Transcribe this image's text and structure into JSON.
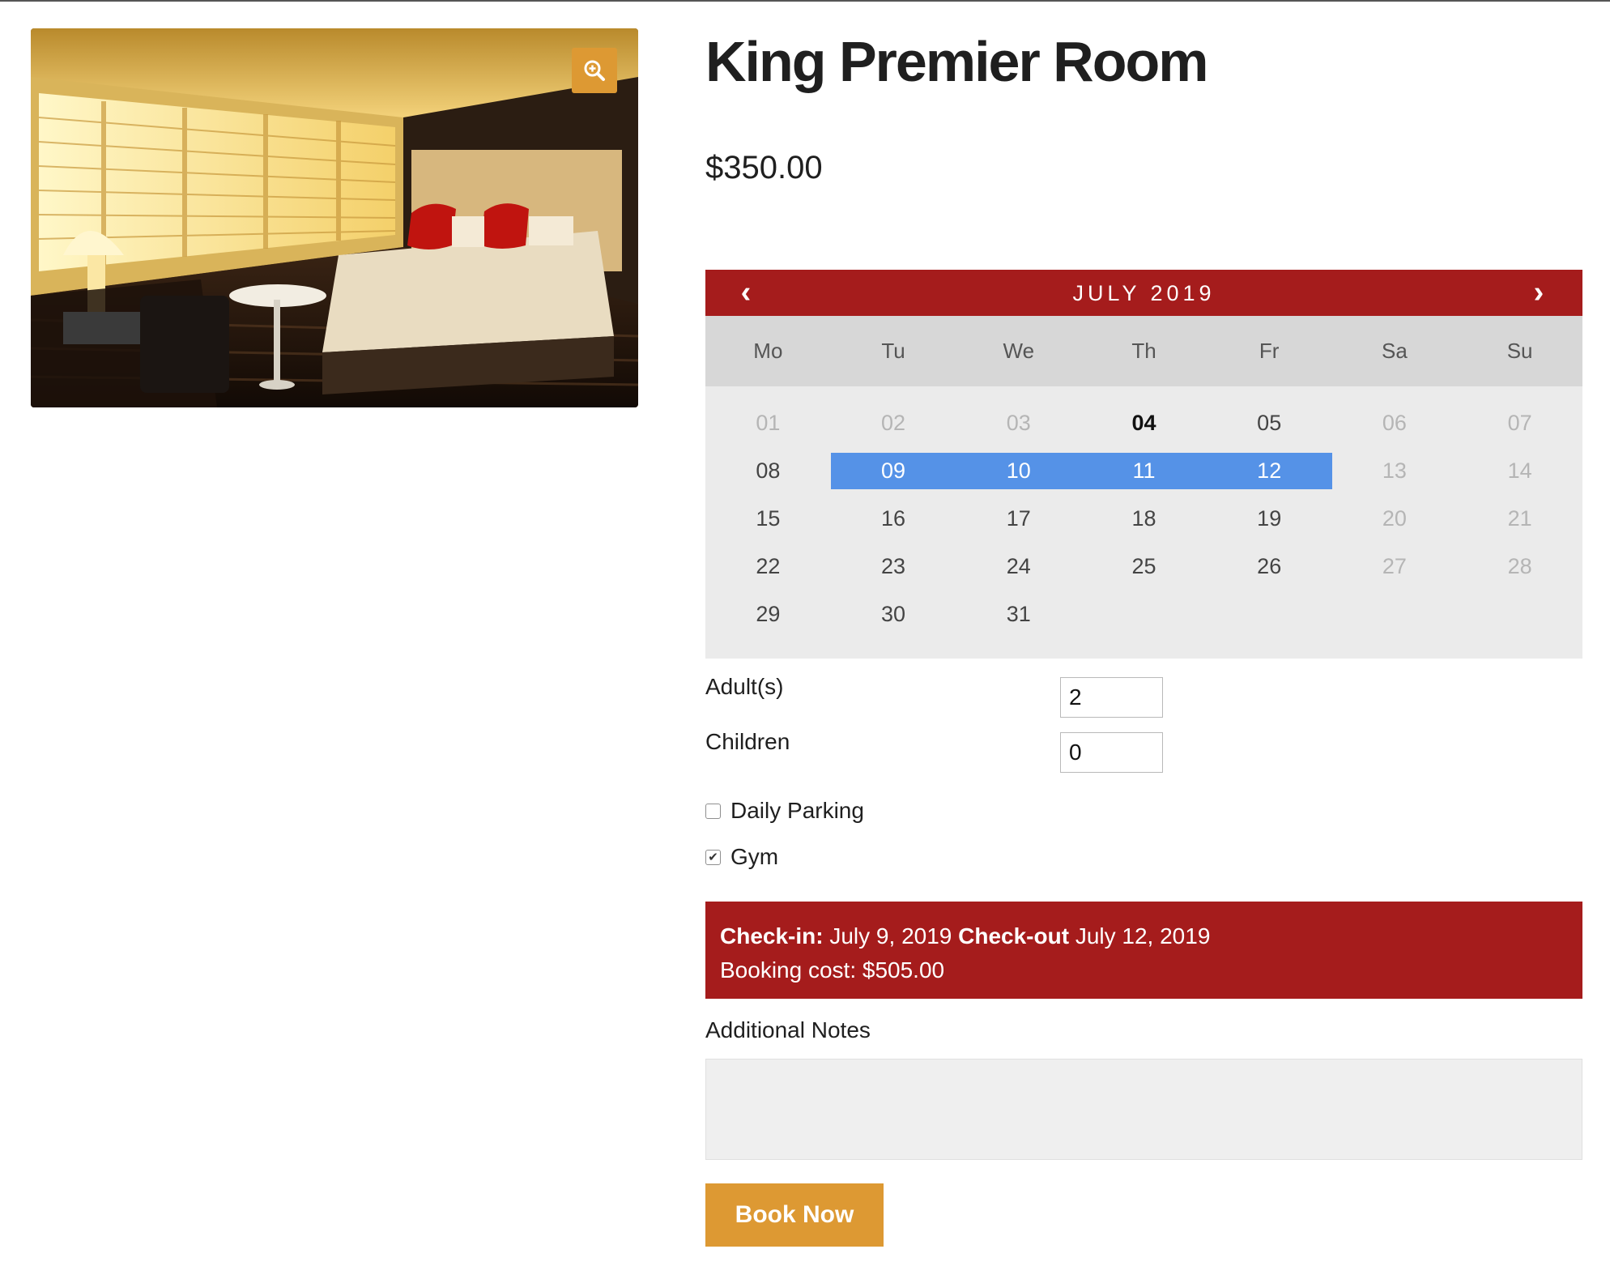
{
  "product": {
    "title": "King Premier Room",
    "price": "$350.00",
    "zoom_icon": "zoom-in-icon"
  },
  "calendar": {
    "month_label": "JULY 2019",
    "prev_symbol": "‹",
    "next_symbol": "›",
    "day_names": [
      "Mo",
      "Tu",
      "We",
      "Th",
      "Fr",
      "Sa",
      "Su"
    ],
    "weeks": [
      [
        {
          "d": "01",
          "s": "disabled"
        },
        {
          "d": "02",
          "s": "disabled"
        },
        {
          "d": "03",
          "s": "disabled"
        },
        {
          "d": "04",
          "s": "today"
        },
        {
          "d": "05",
          "s": "normal"
        },
        {
          "d": "06",
          "s": "disabled"
        },
        {
          "d": "07",
          "s": "disabled"
        }
      ],
      [
        {
          "d": "08",
          "s": "normal"
        },
        {
          "d": "09",
          "s": "selected"
        },
        {
          "d": "10",
          "s": "selected"
        },
        {
          "d": "11",
          "s": "selected"
        },
        {
          "d": "12",
          "s": "selected"
        },
        {
          "d": "13",
          "s": "disabled"
        },
        {
          "d": "14",
          "s": "disabled"
        }
      ],
      [
        {
          "d": "15",
          "s": "normal"
        },
        {
          "d": "16",
          "s": "normal"
        },
        {
          "d": "17",
          "s": "normal"
        },
        {
          "d": "18",
          "s": "normal"
        },
        {
          "d": "19",
          "s": "normal"
        },
        {
          "d": "20",
          "s": "disabled"
        },
        {
          "d": "21",
          "s": "disabled"
        }
      ],
      [
        {
          "d": "22",
          "s": "normal"
        },
        {
          "d": "23",
          "s": "normal"
        },
        {
          "d": "24",
          "s": "normal"
        },
        {
          "d": "25",
          "s": "normal"
        },
        {
          "d": "26",
          "s": "normal"
        },
        {
          "d": "27",
          "s": "disabled"
        },
        {
          "d": "28",
          "s": "disabled"
        }
      ],
      [
        {
          "d": "29",
          "s": "normal"
        },
        {
          "d": "30",
          "s": "normal"
        },
        {
          "d": "31",
          "s": "normal"
        },
        {
          "d": "",
          "s": "empty"
        },
        {
          "d": "",
          "s": "empty"
        },
        {
          "d": "",
          "s": "empty"
        },
        {
          "d": "",
          "s": "empty"
        }
      ]
    ],
    "header_color": "#a51c1c",
    "selected_color": "#5592e7"
  },
  "guests": {
    "adults_label": "Adult(s)",
    "adults_value": "2",
    "children_label": "Children",
    "children_value": "0"
  },
  "extras": [
    {
      "label": "Daily Parking",
      "checked": false
    },
    {
      "label": "Gym",
      "checked": true
    }
  ],
  "summary": {
    "checkin_label": "Check-in:",
    "checkin_value": "July 9, 2019",
    "checkout_label": "Check-out",
    "checkout_value": "July 12, 2019",
    "cost_label": "Booking cost:",
    "cost_value": "$505.00"
  },
  "notes": {
    "label": "Additional Notes",
    "value": ""
  },
  "actions": {
    "book_label": "Book Now",
    "accent_color": "#dd9933"
  }
}
